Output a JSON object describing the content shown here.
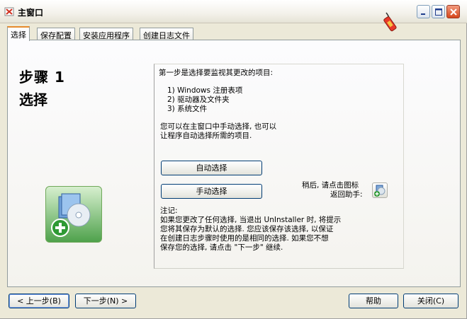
{
  "window": {
    "title": "主窗口"
  },
  "tabs": [
    {
      "label": "选择"
    },
    {
      "label": "保存配置"
    },
    {
      "label": "安装应用程序"
    },
    {
      "label": "创建日志文件"
    }
  ],
  "step": {
    "title": "步骤 1",
    "subtitle": "选择"
  },
  "content": {
    "intro": "第一步是选择要监视其更改的项目:",
    "items": [
      "1) Windows 注册表项",
      "2) 驱动器及文件夹",
      "3) 系统文件"
    ],
    "desc_line1": "您可以在主窗口中手动选择, 也可以",
    "desc_line2": "让程序自动选择所需的项目.",
    "auto_button": "自动选择",
    "manual_button": "手动选择",
    "later_line1": "稍后, 请点击图标",
    "later_line2": "返回助手:",
    "note_title": "注记:",
    "note_lines": [
      "如果您更改了任何选择, 当退出 UnInstaller 时, 将提示",
      "您将其保存为默认的选择. 您应该保存该选择, 以保证",
      "在创建日志步骤时使用的是相同的选择. 如果您不想",
      "保存您的选择, 请点击 \"下一步\" 继续."
    ]
  },
  "footer": {
    "back": "< 上一步(B)",
    "next": "下一步(N) >",
    "help": "帮助",
    "close": "关闭(C)"
  },
  "colors": {
    "active_tab_accent": "#E68B2C",
    "close_button": "#D5461B",
    "icon_green": "#4FA24C"
  },
  "icons": [
    "app-icon",
    "firecracker-icon",
    "minimize-icon",
    "maximize-icon",
    "close-icon",
    "install-cd-icon",
    "assistant-icon"
  ]
}
